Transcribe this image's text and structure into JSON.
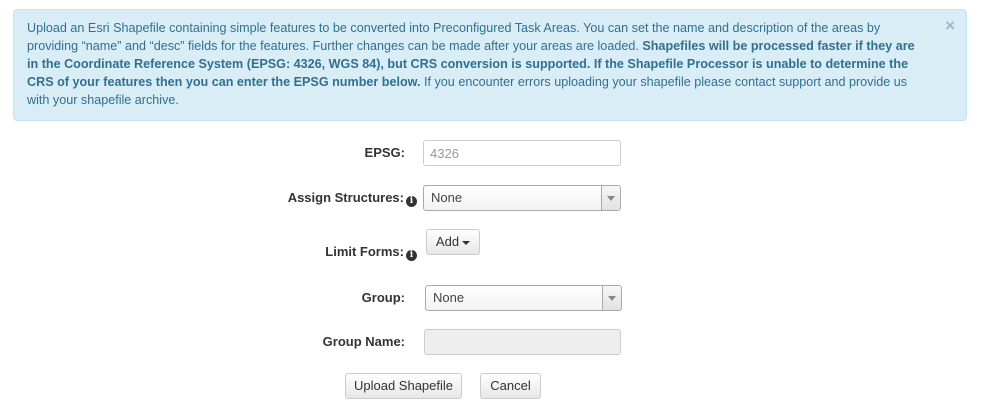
{
  "alert": {
    "text_1": "Upload an Esri Shapefile containing simple features to be converted into Preconfigured Task Areas. You can set the name and description of the areas by providing “name” and “desc” fields for the features. Further changes can be made after your areas are loaded. ",
    "bold_1": "Shapefiles will be processed faster if they are in the Coordinate Reference System (EPSG: 4326, WGS 84), but CRS conversion is supported. If the Shapefile Processor is unable to determine the CRS of your features then you can enter the EPSG number below.",
    "text_2": " If you encounter errors uploading your shapefile please contact support and provide us with your shapefile archive.",
    "close": "×"
  },
  "form": {
    "epsg": {
      "label": "EPSG:",
      "placeholder": "4326",
      "value": ""
    },
    "assign_structures": {
      "label": "Assign Structures:",
      "selected": "None"
    },
    "limit_forms": {
      "label": "Limit Forms:",
      "button": "Add"
    },
    "group": {
      "label": "Group:",
      "selected": "None"
    },
    "group_name": {
      "label": "Group Name:",
      "value": ""
    }
  },
  "actions": {
    "upload": "Upload Shapefile",
    "cancel": "Cancel"
  },
  "icons": {
    "info": "i"
  },
  "colors": {
    "alert_bg": "#d9edf7",
    "alert_text": "#31708f",
    "alert_border": "#bce8f1"
  }
}
